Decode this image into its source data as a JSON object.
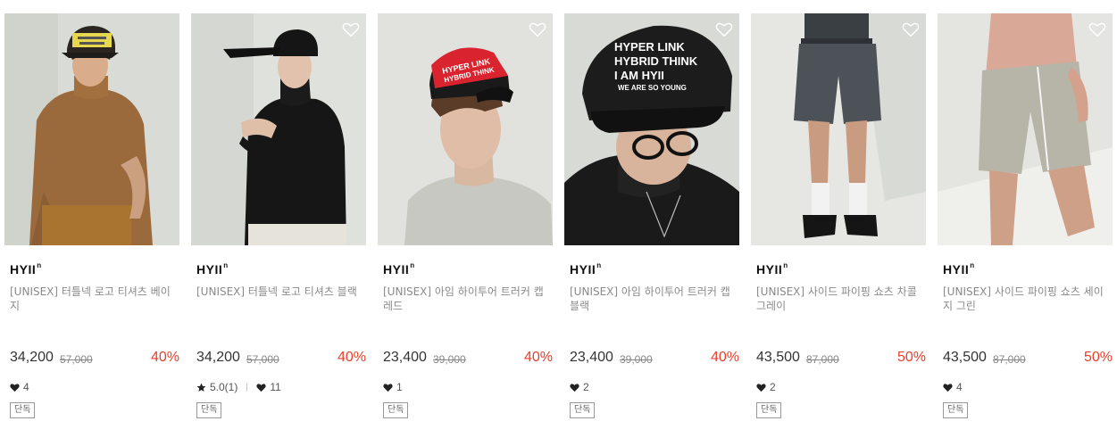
{
  "colors": {
    "discount": "#e8402c",
    "text": "#222222",
    "muted": "#8a8a8a"
  },
  "products": [
    {
      "brand": "HYII",
      "brand_sup": "n",
      "name": "[UNISEX] 터틀넥 로고 티셔츠 베이지",
      "price": "34,200",
      "original_price": "57,000",
      "discount": "40%",
      "rating": "",
      "likes": "4",
      "tag": "단독",
      "image": "model-beige-turtleneck-cap"
    },
    {
      "brand": "HYII",
      "brand_sup": "n",
      "name": "[UNISEX] 터틀넥 로고 티셔츠 블랙",
      "price": "34,200",
      "original_price": "57,000",
      "discount": "40%",
      "rating": "5.0(1)",
      "likes": "11",
      "tag": "단독",
      "image": "model-black-turtleneck-cap"
    },
    {
      "brand": "HYII",
      "brand_sup": "n",
      "name": "[UNISEX] 아임 하이투어 트러커 캡 레드",
      "price": "23,400",
      "original_price": "39,000",
      "discount": "40%",
      "rating": "",
      "likes": "1",
      "tag": "단독",
      "image": "model-red-trucker-cap"
    },
    {
      "brand": "HYII",
      "brand_sup": "n",
      "name": "[UNISEX] 아임 하이투어 트러커 캡 블랙",
      "price": "23,400",
      "original_price": "39,000",
      "discount": "40%",
      "rating": "",
      "likes": "2",
      "tag": "단독",
      "image": "model-black-trucker-cap",
      "cap_text": [
        "HYPER LINK",
        "HYBRID THINK",
        "I AM HYII",
        "WE ARE SO YOUNG"
      ]
    },
    {
      "brand": "HYII",
      "brand_sup": "n",
      "name": "[UNISEX] 사이드 파이핑 쇼츠 차콜 그레이",
      "price": "43,500",
      "original_price": "87,000",
      "discount": "50%",
      "rating": "",
      "likes": "2",
      "tag": "단독",
      "image": "model-charcoal-shorts"
    },
    {
      "brand": "HYII",
      "brand_sup": "n",
      "name": "[UNISEX] 사이드 파이핑 쇼츠 세이지 그린",
      "price": "43,500",
      "original_price": "87,000",
      "discount": "50%",
      "rating": "",
      "likes": "4",
      "tag": "단독",
      "image": "model-sage-shorts"
    }
  ]
}
